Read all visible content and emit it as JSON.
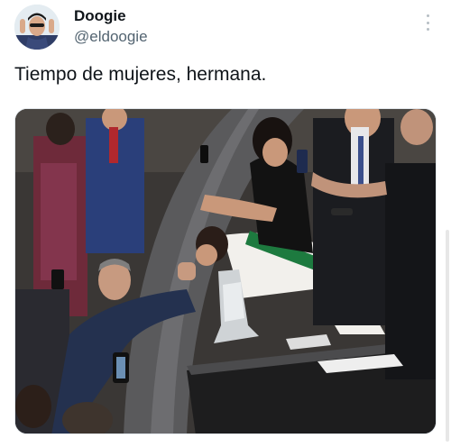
{
  "author": {
    "display_name": "Doogie",
    "handle": "@eldoogie",
    "avatar_icon": "profile-avatar"
  },
  "post": {
    "text": "Tiempo de mujeres, hermana.",
    "more_icon": "more-options-icon"
  },
  "media": {
    "kind": "photo",
    "icon": "photo-image"
  },
  "colors": {
    "text_primary": "#0f1419",
    "text_secondary": "#536471",
    "background": "#ffffff",
    "sash_green": "#1d7a3f",
    "sash_red": "#b8202b"
  }
}
